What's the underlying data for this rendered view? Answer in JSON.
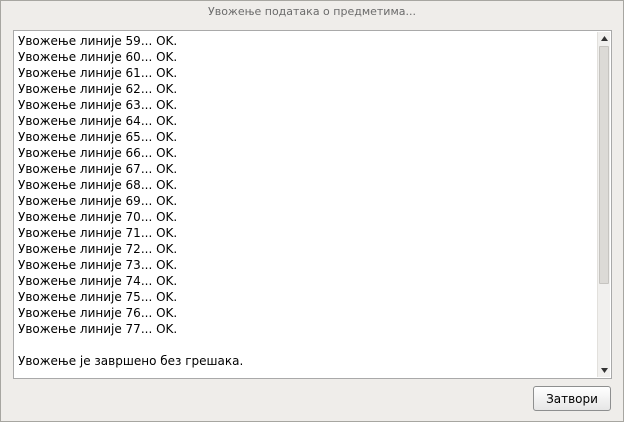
{
  "window": {
    "title": "Увожење података о предметима..."
  },
  "log": {
    "lines": [
      "Увожење линије 59... OK.",
      "Увожење линије 60... OK.",
      "Увожење линије 61... OK.",
      "Увожење линије 62... OK.",
      "Увожење линије 63... OK.",
      "Увожење линије 64... OK.",
      "Увожење линије 65... OK.",
      "Увожење линије 66... OK.",
      "Увожење линије 67... OK.",
      "Увожење линије 68... OK.",
      "Увожење линије 69... OK.",
      "Увожење линије 70... OK.",
      "Увожење линије 71... OK.",
      "Увожење линије 72... OK.",
      "Увожење линије 73... OK.",
      "Увожење линије 74... OK.",
      "Увожење линије 75... OK.",
      "Увожење линије 76... OK.",
      "Увожење линије 77... OK."
    ],
    "summary": "Увожење је завршено без грешака."
  },
  "scrollbar": {
    "up_icon": "triangle-up-icon",
    "down_icon": "triangle-down-icon"
  },
  "buttons": {
    "close_label": "Затвори"
  }
}
